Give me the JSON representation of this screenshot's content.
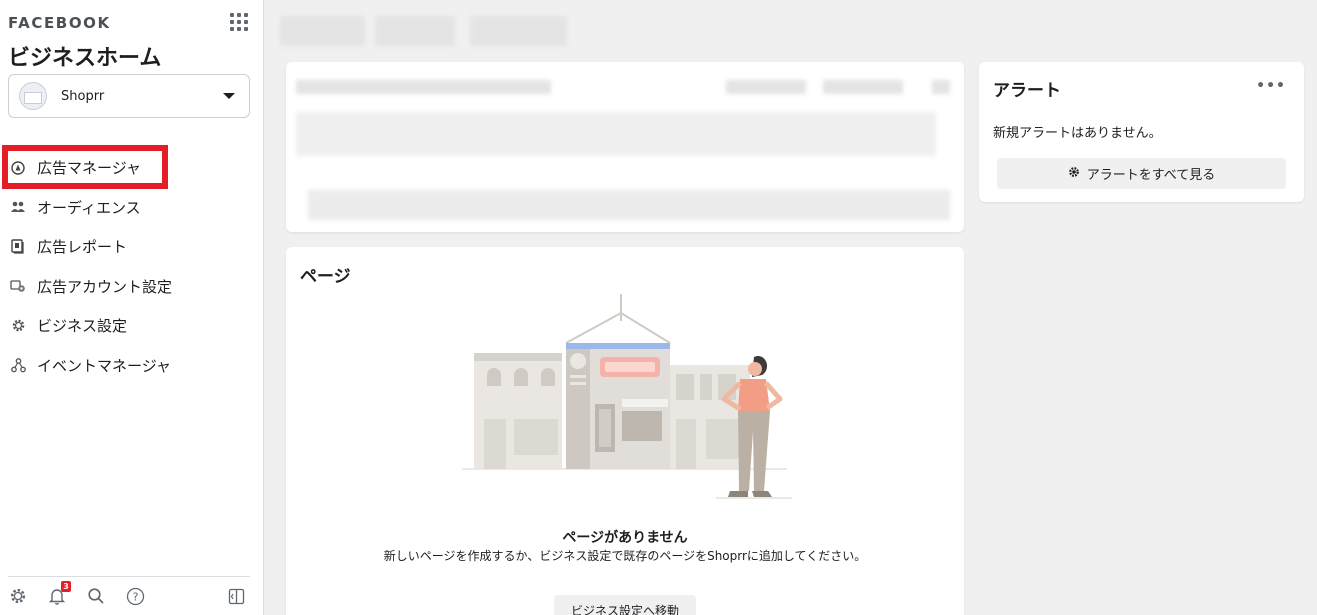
{
  "sidebar": {
    "brand": "FACEBOOK",
    "title": "ビジネスホーム",
    "account_name": "Shoprr",
    "items": [
      {
        "label": "広告マネージャ",
        "icon": "ads-manager-icon"
      },
      {
        "label": "オーディエンス",
        "icon": "audience-icon"
      },
      {
        "label": "広告レポート",
        "icon": "report-icon"
      },
      {
        "label": "広告アカウント設定",
        "icon": "ad-account-settings-icon"
      },
      {
        "label": "ビジネス設定",
        "icon": "gear-icon"
      },
      {
        "label": "イベントマネージャ",
        "icon": "events-icon"
      }
    ],
    "notification_count": "3",
    "highlight_color": "#e41e26"
  },
  "alerts": {
    "title": "アラート",
    "more": "•••",
    "empty_text": "新規アラートはありません。",
    "button_label": "アラートをすべて見る"
  },
  "pages": {
    "title": "ページ",
    "empty_title": "ページがありません",
    "empty_desc": "新しいページを作成するか、ビジネス設定で既存のページをShoprrに追加してください。",
    "button_label": "ビジネス設定へ移動"
  }
}
